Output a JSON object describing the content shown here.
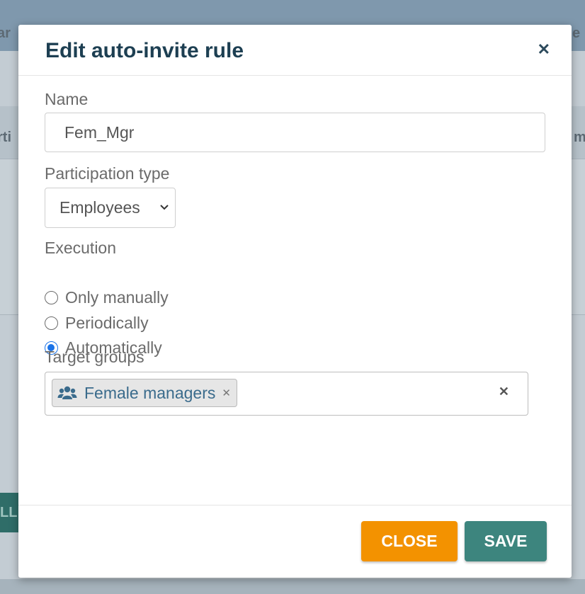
{
  "background": {
    "fragments": [
      "ar",
      "rti",
      "m",
      "e",
      "LL"
    ]
  },
  "modal": {
    "title": "Edit auto-invite rule",
    "close_icon": "close-icon"
  },
  "form": {
    "name_label": "Name",
    "name_value": "Fem_Mgr",
    "participation_label": "Participation type",
    "participation_value": "Employees",
    "execution_label": "Execution",
    "execution_options": [
      {
        "label": "Only manually",
        "selected": false
      },
      {
        "label": "Periodically",
        "selected": false
      },
      {
        "label": "Automatically",
        "selected": true
      }
    ],
    "target_groups_label": "Target groups",
    "target_groups": [
      {
        "label": "Female managers",
        "icon": "users-icon"
      }
    ]
  },
  "footer": {
    "close_label": "CLOSE",
    "save_label": "SAVE"
  },
  "colors": {
    "title": "#1d3f52",
    "close_button": "#f39200",
    "save_button": "#3d857e",
    "tag_text": "#3a6b8c",
    "radio_checked": "#1a73e8"
  }
}
